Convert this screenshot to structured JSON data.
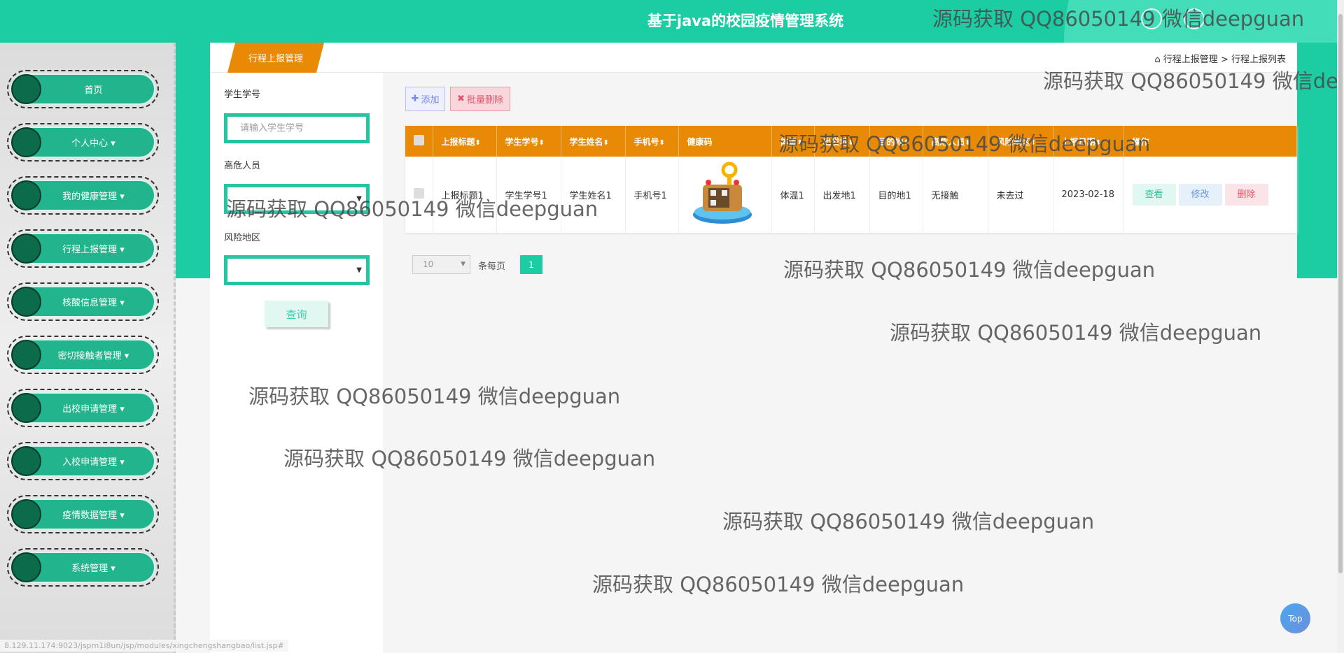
{
  "header": {
    "title": "基于java的校园疫情管理系统"
  },
  "sidebar": {
    "items": [
      {
        "label": "首页"
      },
      {
        "label": "个人中心 ▾"
      },
      {
        "label": "我的健康管理 ▾"
      },
      {
        "label": "行程上报管理 ▾"
      },
      {
        "label": "核酸信息管理 ▾"
      },
      {
        "label": "密切接触者管理 ▾"
      },
      {
        "label": "出校申请管理 ▾"
      },
      {
        "label": "入校申请管理 ▾"
      },
      {
        "label": "疫情数据管理 ▾"
      },
      {
        "label": "系统管理 ▾"
      }
    ]
  },
  "tab": {
    "label": "行程上报管理"
  },
  "breadcrumb": {
    "home_icon": "home-icon",
    "level1": "行程上报管理",
    "sep": ">",
    "level2": "行程上报列表"
  },
  "filter": {
    "student_no_label": "学生学号",
    "student_no_placeholder": "请输入学生学号",
    "high_risk_label": "高危人员",
    "high_risk_value": "",
    "risk_area_label": "风险地区",
    "risk_area_value": "",
    "query_label": "查询"
  },
  "toolbar": {
    "add_label": "添加",
    "batch_delete_label": "批量删除"
  },
  "table": {
    "columns": [
      "上报标题",
      "学生学号",
      "学生姓名",
      "手机号",
      "健康码",
      "体温",
      "出发地",
      "目的地",
      "高危人员",
      "风险地区",
      "上报日期",
      "操作"
    ],
    "rows": [
      {
        "title": "上报标题1",
        "student_no": "学生学号1",
        "name": "学生姓名1",
        "phone": "手机号1",
        "temp": "体温1",
        "from": "出发地1",
        "to": "目的地1",
        "high_risk": "无接触",
        "risk_area": "未去过",
        "date": "2023-02-18"
      }
    ],
    "actions": {
      "view": "查看",
      "edit": "修改",
      "delete": "删除"
    }
  },
  "pagination": {
    "page_size": "10",
    "per_page_label": "条每页",
    "current_page": "1"
  },
  "watermark": "源码获取 QQ86050149 微信deepguan",
  "back_to_top": "Top",
  "status_url": "8.129.11.174:9023/jspm1i8un/jsp/modules/xingchengshangbao/list.jsp#",
  "colors": {
    "primary": "#1ccda4",
    "accent": "#e98a06",
    "sidebar_item": "#22b48d"
  }
}
